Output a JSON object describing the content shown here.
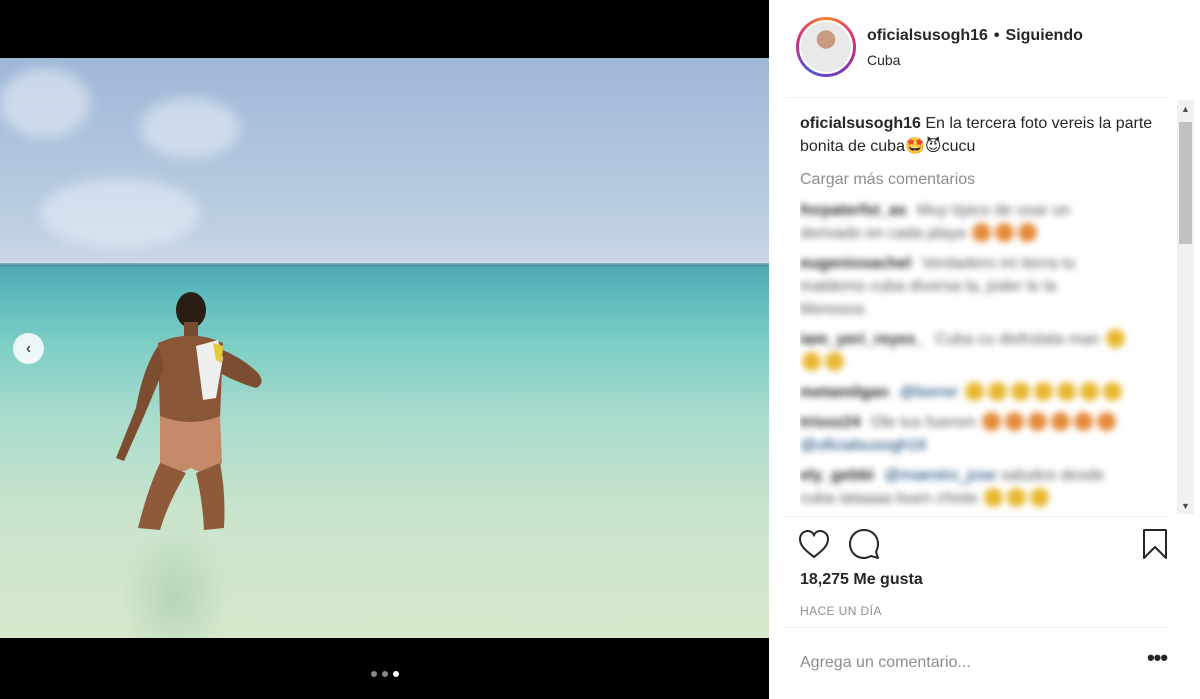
{
  "post": {
    "username": "oficialsusogh16",
    "separator": "•",
    "follow_status": "Siguiendo",
    "location": "Cuba"
  },
  "caption": {
    "username": "oficialsusogh16",
    "text": "En la tercera foto vereis la parte bonita de cuba",
    "emoji_1": "🤩",
    "emoji_2": "😈",
    "suffix": "cucu"
  },
  "load_more_label": "Cargar más comentarios",
  "comments": [
    {
      "user": "fnrpaterfst_as",
      "text": "Muy típico de usar un",
      "text2": "derivado en cada playa"
    },
    {
      "user": "eugeniosachel",
      "text": "Verdadero mi tierra tu",
      "text2": "maldemo cuba diversa la, joder le la",
      "text3": "Menosos"
    },
    {
      "user": "iam_yeri_reyes_",
      "text": "Cuba cu disfrútala man"
    },
    {
      "user": "metamilgan",
      "link": "@borrer"
    },
    {
      "user": "trisoz24",
      "text": "Ole tus fuerom",
      "link": "@oficialsusogh16"
    },
    {
      "user": "ely_gebbi",
      "link": "@maestro_jose",
      "text": "saludos desde",
      "text2": "cuba iataaaa buen chiste"
    }
  ],
  "likes_label": "18,275 Me gusta",
  "timestamp": "HACE UN DÍA",
  "comment_input": {
    "placeholder": "Agrega un comentario...",
    "value": ""
  },
  "more_options_label": "•••",
  "carousel": {
    "total": 3,
    "active_index": 2
  },
  "icons": {
    "heart": "heart-icon",
    "comment": "comment-icon",
    "bookmark": "bookmark-icon",
    "prev": "chevron-left-icon"
  },
  "colors": {
    "link": "#00376b",
    "muted": "#8e8e8e",
    "text": "#262626"
  }
}
